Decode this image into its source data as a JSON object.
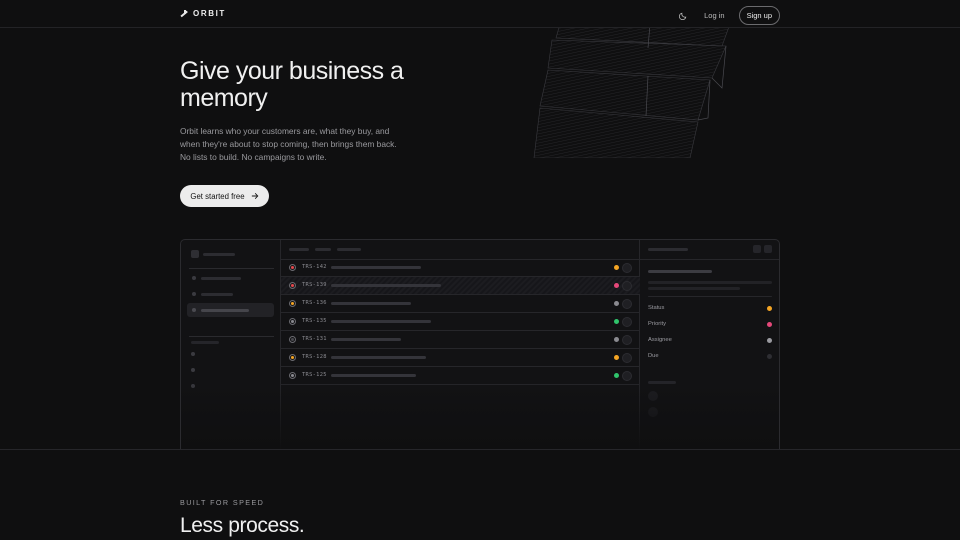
{
  "nav": {
    "brand": "ORBIT",
    "login_label": "Log in",
    "signup_label": "Sign up"
  },
  "hero": {
    "title": "Give your business a memory",
    "subtitle": "Orbit learns who your customers are, what they buy, and when they're about to stop coming, then brings them back. No lists to build. No campaigns to write.",
    "cta_label": "Get started free"
  },
  "app_mock": {
    "rows": [
      {
        "id": "TRS-142",
        "icon_color": "#e5484d",
        "status_color": "#f5a524"
      },
      {
        "id": "TRS-139",
        "icon_color": "#e5484d",
        "status_color": "#e5487a"
      },
      {
        "id": "TRS-136",
        "icon_color": "#f5a524",
        "status_color": "#8a8a90"
      },
      {
        "id": "TRS-135",
        "icon_color": "#8a8a90",
        "status_color": "#30c46c"
      },
      {
        "id": "TRS-131",
        "icon_color": "#4a4a50",
        "status_color": "#8a8a90"
      },
      {
        "id": "TRS-128",
        "icon_color": "#f5a524",
        "status_color": "#f5a524"
      },
      {
        "id": "TRS-125",
        "icon_color": "#8a8a90",
        "status_color": "#30c46c"
      }
    ],
    "detail": {
      "properties": [
        {
          "label": "Status",
          "color": "#f5a524"
        },
        {
          "label": "Priority",
          "color": "#e5487a"
        },
        {
          "label": "Assignee",
          "color": "#9a9aa0"
        },
        {
          "label": "Due",
          "color": "#2e2e33"
        }
      ]
    }
  },
  "section": {
    "eyebrow": "BUILT FOR SPEED",
    "title": "Less process."
  },
  "colors": {
    "background": "#0f0f10",
    "cta_bg": "#ececec",
    "text": "#f0f0f0",
    "muted": "#9a9a9e"
  },
  "icons": {
    "brand": "orbit-logo-icon",
    "theme": "moon-icon",
    "cta": "arrow-right-icon"
  }
}
